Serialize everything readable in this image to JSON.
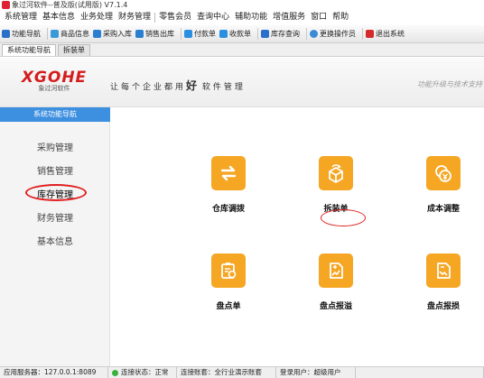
{
  "window": {
    "title": "象过河软件--普及版(试用版) V7.1.4"
  },
  "menu": [
    "系统管理",
    "基本信息",
    "业务处理",
    "财务管理",
    "零售会员",
    "查询中心",
    "辅助功能",
    "增值服务",
    "窗口",
    "帮助"
  ],
  "toolbar": [
    {
      "label": "功能导航",
      "icon": "home-icon",
      "color": "#2a6fc9"
    },
    {
      "label": "商品信息",
      "icon": "product-info-icon",
      "color": "#3a9ad9"
    },
    {
      "label": "采购入库",
      "icon": "purchase-in-icon",
      "color": "#2a7fd0"
    },
    {
      "label": "销售出库",
      "icon": "sales-out-icon",
      "color": "#2a7fd0"
    },
    {
      "label": "付款单",
      "icon": "payment-icon",
      "color": "#2a8fe0"
    },
    {
      "label": "收款单",
      "icon": "receipt-icon",
      "color": "#2a8fe0"
    },
    {
      "label": "库存查询",
      "icon": "stock-query-icon",
      "color": "#2a6fc9"
    },
    {
      "label": "更换操作员",
      "icon": "switch-operator-icon",
      "color": "#3b8ad8"
    },
    {
      "label": "退出系统",
      "icon": "exit-icon",
      "color": "#d42a2a"
    }
  ],
  "tabs": [
    {
      "label": "系统功能导航",
      "active": true
    },
    {
      "label": "拆装单",
      "active": false
    }
  ],
  "banner": {
    "brand": "XGOHE",
    "brand_sub": "象过河软件",
    "slogan_pre": "让每个企业都用",
    "slogan_big": "好",
    "slogan_post": "软件管理",
    "upgrade": "功能升级与技术支持"
  },
  "sidebar": {
    "header": "系统功能导航",
    "items": [
      {
        "label": "采购管理",
        "active": false
      },
      {
        "label": "销售管理",
        "active": false
      },
      {
        "label": "库存管理",
        "active": true
      },
      {
        "label": "财务管理",
        "active": false
      },
      {
        "label": "基本信息",
        "active": false
      }
    ]
  },
  "tiles": [
    {
      "label": "仓库调拨",
      "icon": "transfer-icon"
    },
    {
      "label": "拆装单",
      "icon": "assembly-box-icon",
      "highlighted": true
    },
    {
      "label": "成本调整",
      "icon": "cost-adjust-icon"
    },
    {
      "label": "盘点单",
      "icon": "stocktake-icon"
    },
    {
      "label": "盘点报溢",
      "icon": "overage-report-icon"
    },
    {
      "label": "盘点报损",
      "icon": "loss-report-icon"
    }
  ],
  "status": {
    "server": "应用服务器：127.0.0.1:8089",
    "connection": "连接状态：正常",
    "ledger": "连接账套：全行业演示账套",
    "user": "登录用户：超级用户",
    "connection_color": "#3bb13b"
  },
  "colors": {
    "accent": "#3d8fe0",
    "tile": "#f5a623",
    "highlight": "#e02020",
    "brand": "#d41c1c"
  }
}
